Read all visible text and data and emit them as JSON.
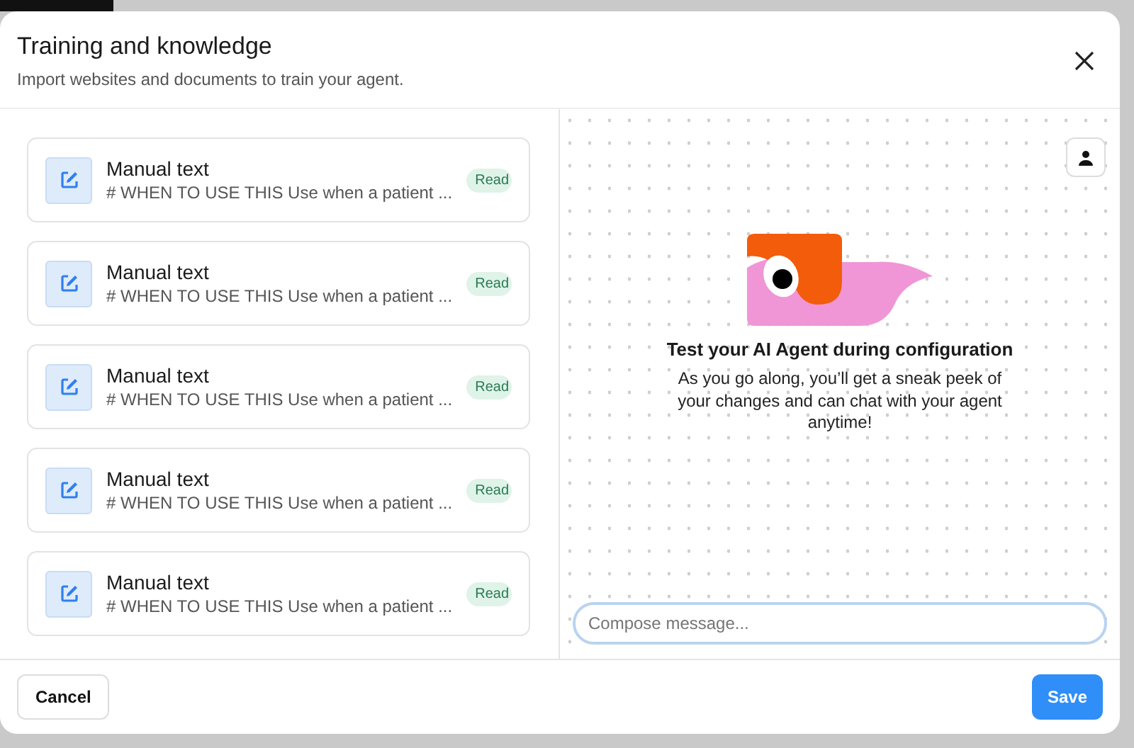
{
  "dialog": {
    "title": "Training and knowledge",
    "subtitle": "Import websites and documents to train your agent."
  },
  "sources": [
    {
      "title": "Manual text",
      "snippet": "# WHEN TO USE THIS Use when a patient ...",
      "status": "Read"
    },
    {
      "title": "Manual text",
      "snippet": "# WHEN TO USE THIS Use when a patient ...",
      "status": "Read"
    },
    {
      "title": "Manual text",
      "snippet": "# WHEN TO USE THIS Use when a patient ...",
      "status": "Read"
    },
    {
      "title": "Manual text",
      "snippet": "# WHEN TO USE THIS Use when a patient ...",
      "status": "Read"
    },
    {
      "title": "Manual text",
      "snippet": "# WHEN TO USE THIS Use when a patient ...",
      "status": "Read"
    }
  ],
  "preview": {
    "heading": "Test your AI Agent during configuration",
    "body": "As you go along, you’ll get a sneak peek of your changes and can chat with your agent anytime!",
    "composer": {
      "placeholder": "Compose message..."
    }
  },
  "footer": {
    "cancel": "Cancel",
    "save": "Save"
  }
}
